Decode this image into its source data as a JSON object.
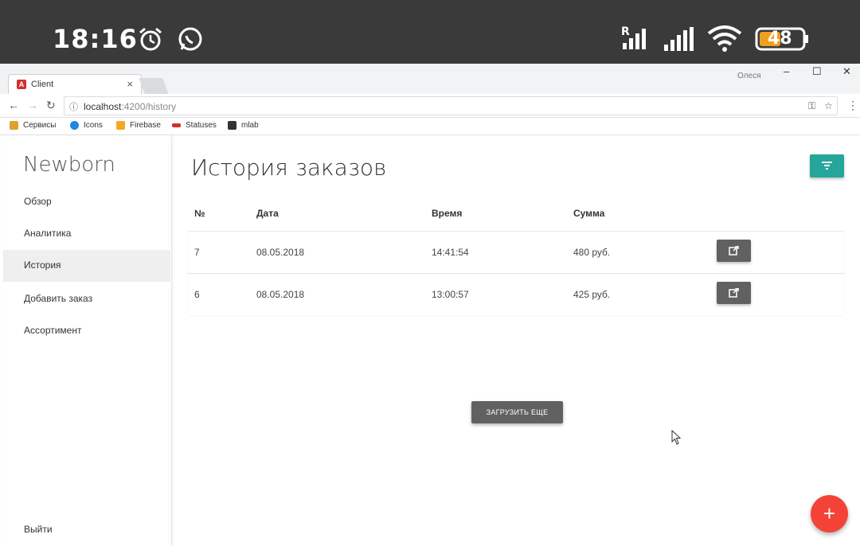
{
  "status_bar": {
    "time": "18:16",
    "battery": "48",
    "signal_label": "R"
  },
  "browser": {
    "tab_title": "Client",
    "tab_close": "×",
    "window_user": "Олеся",
    "window_controls": [
      "–",
      "☐",
      "✕"
    ],
    "url_host": "localhost",
    "url_path": ":4200/history",
    "bookmarks": [
      {
        "label": "Сервисы",
        "color": "#e0a030"
      },
      {
        "label": "Icons",
        "color": "#1e88e5"
      },
      {
        "label": "Firebase",
        "color": "#f5a623"
      },
      {
        "label": "Statuses",
        "color": "#d32f2f"
      },
      {
        "label": "mlab",
        "color": "#333333"
      }
    ]
  },
  "sidebar": {
    "brand": "Newborn",
    "items": [
      {
        "label": "Обзор",
        "active": false
      },
      {
        "label": "Аналитика",
        "active": false
      },
      {
        "label": "История",
        "active": true
      },
      {
        "label": "Добавить заказ",
        "active": false
      },
      {
        "label": "Ассортимент",
        "active": false
      }
    ],
    "logout": "Выйти"
  },
  "main": {
    "title": "История заказов",
    "table": {
      "headers": [
        "№",
        "Дата",
        "Время",
        "Сумма"
      ],
      "rows": [
        {
          "num": "7",
          "date": "08.05.2018",
          "time": "14:41:54",
          "sum": "480 руб."
        },
        {
          "num": "6",
          "date": "08.05.2018",
          "time": "13:00:57",
          "sum": "425 руб."
        }
      ]
    },
    "load_more": "ЗАГРУЗИТЬ ЕЩЕ",
    "fab_label": "+"
  },
  "colors": {
    "accent_teal": "#26a69a",
    "button_grey": "#616161",
    "fab_red": "#f44336"
  }
}
